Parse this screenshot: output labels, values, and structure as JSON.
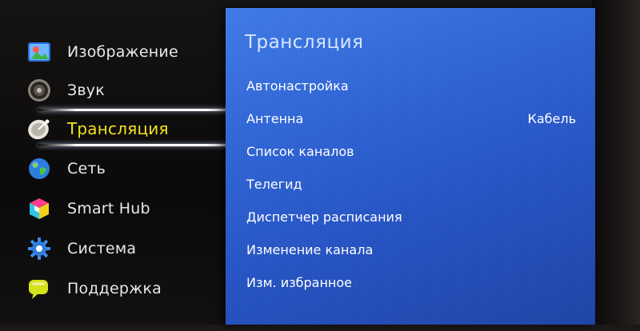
{
  "left_menu": {
    "items": [
      {
        "label": "Изображение",
        "icon": "picture-icon"
      },
      {
        "label": "Звук",
        "icon": "speaker-icon"
      },
      {
        "label": "Трансляция",
        "icon": "satellite-dish-icon",
        "selected": true
      },
      {
        "label": "Сеть",
        "icon": "globe-icon"
      },
      {
        "label": "Smart Hub",
        "icon": "smart-hub-cube-icon"
      },
      {
        "label": "Система",
        "icon": "gear-icon"
      },
      {
        "label": "Поддержка",
        "icon": "speech-bubble-icon"
      }
    ],
    "selected_color": "#f4e21c"
  },
  "panel": {
    "title": "Трансляция",
    "background_color": "#2f66d9",
    "items": [
      {
        "label": "Автонастройка",
        "value": ""
      },
      {
        "label": "Антенна",
        "value": "Кабель"
      },
      {
        "label": "Список каналов",
        "value": ""
      },
      {
        "label": "Телегид",
        "value": ""
      },
      {
        "label": "Диспетчер расписания",
        "value": ""
      },
      {
        "label": "Изменение канала",
        "value": ""
      },
      {
        "label": "Изм. избранное",
        "value": ""
      }
    ]
  }
}
